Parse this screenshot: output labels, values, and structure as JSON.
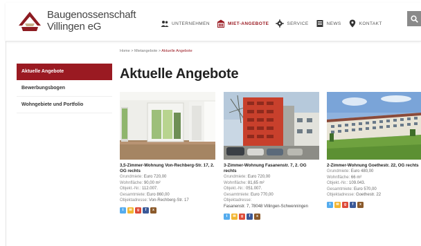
{
  "brand": {
    "line1": "Baugenossenschaft",
    "line2": "Villingen eG"
  },
  "nav": [
    {
      "label": "UNTERNEHMEN",
      "icon": "people-icon"
    },
    {
      "label": "MIET-ANGEBOTE",
      "icon": "building-icon",
      "active": true
    },
    {
      "label": "SERVICE",
      "icon": "gear-icon"
    },
    {
      "label": "NEWS",
      "icon": "newspaper-icon"
    },
    {
      "label": "KONTAKT",
      "icon": "map-pin-icon"
    }
  ],
  "breadcrumb": {
    "home": "Home",
    "sep": ">",
    "parent": "Mietangebote",
    "current": "Aktuelle Angebote"
  },
  "sidebar": [
    {
      "label": "Aktuelle Angebote",
      "active": true
    },
    {
      "label": "Bewerbungsbogen"
    },
    {
      "label": "Wohngebiete und Portfolio"
    }
  ],
  "page_title": "Aktuelle Angebote",
  "listings": [
    {
      "title": "3,5-Zimmer-Wohnung Von-Rechberg-Str. 17, 2. OG rechts",
      "rows": [
        {
          "label": "Grundmiete:",
          "value": "Euro 720,00"
        },
        {
          "label": "Wohnfläche:",
          "value": "90,00 m²"
        },
        {
          "label": "Objekt.-Nr.:",
          "value": "112.007."
        },
        {
          "label": "Gesamtmiete:",
          "value": "Euro 860,00"
        },
        {
          "label": "Objektadresse:",
          "value": "Von-Rechberg-Str. 17"
        }
      ]
    },
    {
      "title": "3-Zimmer-Wohnung Fasanenstr. 7, 2. OG rechts",
      "rows": [
        {
          "label": "Grundmiete:",
          "value": "Euro 720,00"
        },
        {
          "label": "Wohnfläche:",
          "value": "81,65 m²"
        },
        {
          "label": "Objekt.-Nr.:",
          "value": "051.007."
        },
        {
          "label": "Gesamtmiete:",
          "value": "Euro 770,00"
        },
        {
          "label": "Objektadresse:",
          "value": ""
        }
      ],
      "address": "Fasanenstr. 7, 78048 Villingen-Schwenningen"
    },
    {
      "title": "2-Zimmer-Wohnung Goethestr. 22, OG rechts",
      "rows": [
        {
          "label": "Grundmiete:",
          "value": "Euro 480,00"
        },
        {
          "label": "Wohnfläche:",
          "value": "66 m²"
        },
        {
          "label": "Objekt.-Nr.:",
          "value": "109.043."
        },
        {
          "label": "Gesamtmiete:",
          "value": "Euro 570,00"
        },
        {
          "label": "Objektadresse:",
          "value": "Goethestr. 22"
        }
      ]
    }
  ],
  "share_icons": [
    {
      "name": "twitter-icon",
      "color": "#55acee",
      "glyph": "t"
    },
    {
      "name": "mail-icon",
      "color": "#f2b632",
      "glyph": "✉"
    },
    {
      "name": "google-plus-icon",
      "color": "#dd4b39",
      "glyph": "g"
    },
    {
      "name": "facebook-icon",
      "color": "#3b5998",
      "glyph": "f"
    },
    {
      "name": "xing-icon",
      "color": "#8b5a2b",
      "glyph": "x"
    }
  ],
  "colors": {
    "accent": "#9a1a22",
    "search_bg": "#8a8a8a"
  }
}
